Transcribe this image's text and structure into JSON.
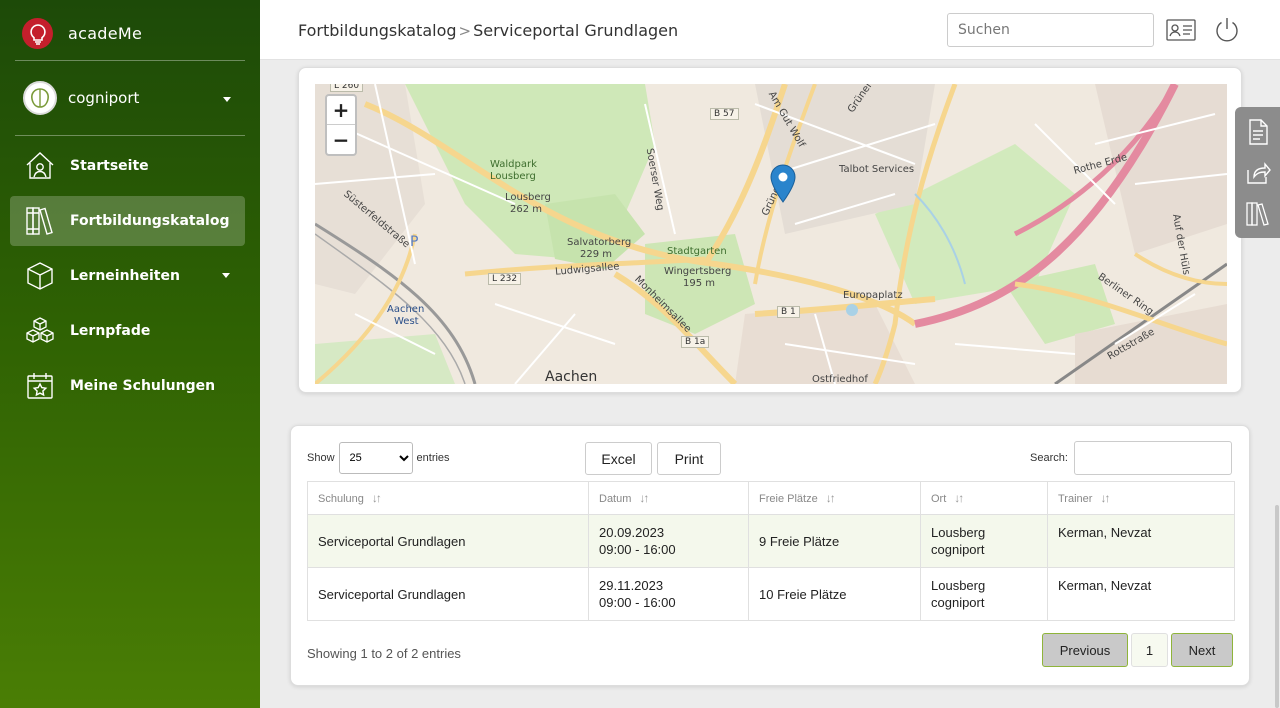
{
  "brand": {
    "name": "acadeMe",
    "logo_color": "#c41f2c"
  },
  "org": {
    "name": "cogniport"
  },
  "sidebar": {
    "items": [
      {
        "label": "Startseite",
        "icon": "home-icon"
      },
      {
        "label": "Fortbildungskatalog",
        "icon": "books-icon",
        "active": true
      },
      {
        "label": "Lerneinheiten",
        "icon": "cube-icon",
        "has_dropdown": true
      },
      {
        "label": "Lernpfade",
        "icon": "cubes-icon"
      },
      {
        "label": "Meine Schulungen",
        "icon": "calendar-star-icon"
      }
    ]
  },
  "header": {
    "breadcrumb": [
      "Fortbildungskatalog",
      "Serviceportal Grundlagen"
    ],
    "search_placeholder": "Suchen"
  },
  "map": {
    "zoom_in": "+",
    "zoom_out": "−",
    "labels": {
      "waldpark": "Waldpark",
      "lousberg": "Lousberg",
      "lousberg_elev": "Lousberg",
      "lousberg_m": "262 m",
      "salvatorberg": "Salvatorberg",
      "salvatorberg_m": "229 m",
      "stadtgarten": "Stadtgarten",
      "wingertsberg": "Wingertsberg",
      "wingertsberg_m": "195 m",
      "ludwigsallee": "Ludwigsallee",
      "monheimsallee": "Monheimsallee",
      "soerser": "Soerser Weg",
      "talbot": "Talbot Services",
      "europaplatz": "Europaplatz",
      "rothe_erde": "Rothe Erde",
      "aachen_west": "Aachen",
      "aachen_west2": "West",
      "aachen": "Aachen",
      "ostfriedhof": "Ostfriedhof",
      "berliner_ring": "Berliner Ring",
      "rottstrasse": "Rottstraße",
      "auf_der_huls": "Auf der Hüls",
      "am_gut_wolf": "Am Gut Wolf",
      "gruener": "Grüner",
      "gruener2": "Grüner",
      "sustereld": "Süsterfeldstraße",
      "b57": "B 57",
      "l232": "L 232",
      "b1": "B 1",
      "b1a": "B 1a",
      "l260": "L 260",
      "p": "P"
    }
  },
  "table": {
    "show_label": "Show",
    "entries_label": "entries",
    "page_size": "25",
    "excel_label": "Excel",
    "print_label": "Print",
    "search_label": "Search:",
    "columns": [
      "Schulung",
      "Datum",
      "Freie Plätze",
      "Ort",
      "Trainer"
    ],
    "rows": [
      {
        "schulung": "Serviceportal Grundlagen",
        "date": "20.09.2023",
        "time": "09:00 - 16:00",
        "plaetze": "9 Freie Plätze",
        "ort1": "Lousberg",
        "ort2": "cogniport",
        "trainer": "Kerman, Nevzat"
      },
      {
        "schulung": "Serviceportal Grundlagen",
        "date": "29.11.2023",
        "time": "09:00 - 16:00",
        "plaetze": "10 Freie Plätze",
        "ort1": "Lousberg",
        "ort2": "cogniport",
        "trainer": "Kerman, Nevzat"
      }
    ],
    "info": "Showing 1 to 2 of 2 entries",
    "prev_label": "Previous",
    "page_number": "1",
    "next_label": "Next"
  }
}
